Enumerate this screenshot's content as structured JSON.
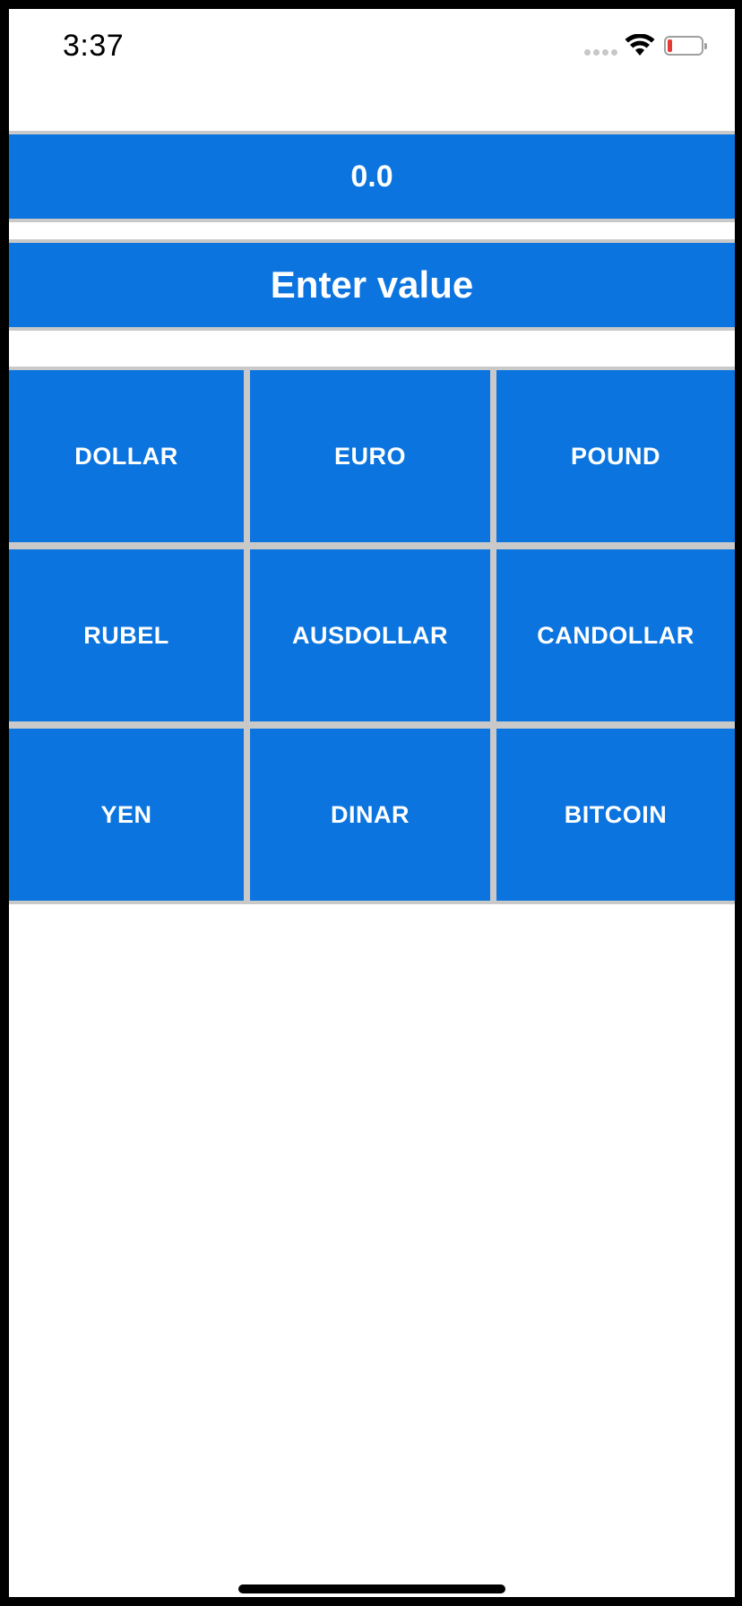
{
  "status_bar": {
    "time": "3:37"
  },
  "result": {
    "value": "0.0"
  },
  "input": {
    "placeholder": "Enter value"
  },
  "currencies": [
    "DOLLAR",
    "EURO",
    "POUND",
    "RUBEL",
    "AUSDOLLAR",
    "CANDOLLAR",
    "YEN",
    "DINAR",
    "BITCOIN"
  ],
  "colors": {
    "accent": "#0b74de",
    "separator": "#c9c9c9",
    "battery_low": "#e53935"
  },
  "icons": [
    "signal-icon",
    "wifi-icon",
    "battery-icon"
  ]
}
